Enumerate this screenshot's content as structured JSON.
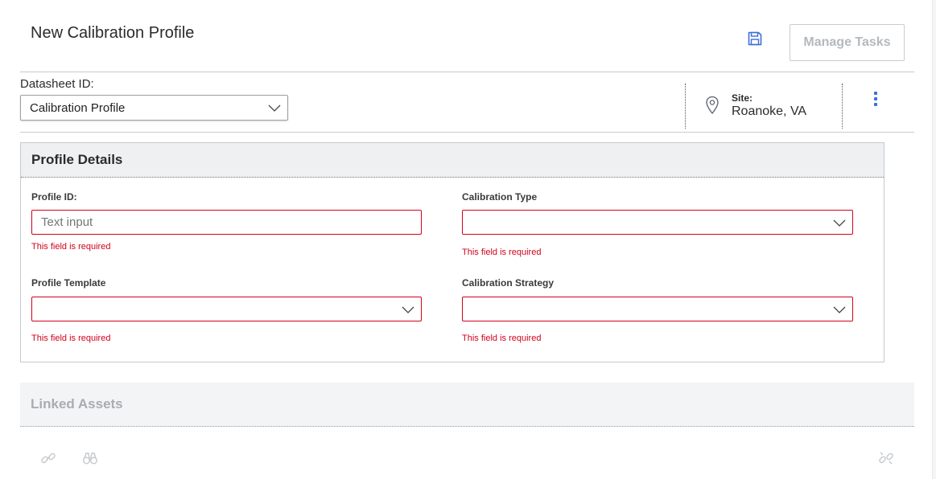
{
  "header": {
    "title": "New Calibration Profile",
    "save_icon": "floppy-disk-icon",
    "manage_tasks_label": "Manage Tasks"
  },
  "datasheet": {
    "label": "Datasheet ID:",
    "selected": "Calibration Profile"
  },
  "site": {
    "label": "Site:",
    "value": "Roanoke, VA",
    "icon": "map-pin-icon"
  },
  "profile_details": {
    "title": "Profile Details",
    "fields": {
      "profile_id": {
        "label": "Profile ID:",
        "placeholder": "Text input",
        "value": "",
        "error": "This field is required"
      },
      "calibration_type": {
        "label": "Calibration Type",
        "value": "",
        "error": "This field is required"
      },
      "profile_template": {
        "label": "Profile Template",
        "value": "",
        "error": "This field is required"
      },
      "calibration_strategy": {
        "label": "Calibration Strategy",
        "value": "",
        "error": "This field is required"
      }
    }
  },
  "linked_assets": {
    "title": "Linked Assets",
    "icons": [
      "link-icon",
      "binoculars-icon",
      "unlink-icon"
    ]
  },
  "colors": {
    "error": "#d0021b",
    "accent": "#3a6fd8",
    "disabled_text": "#b4b9be",
    "panel_header_bg": "#eef0f2"
  }
}
